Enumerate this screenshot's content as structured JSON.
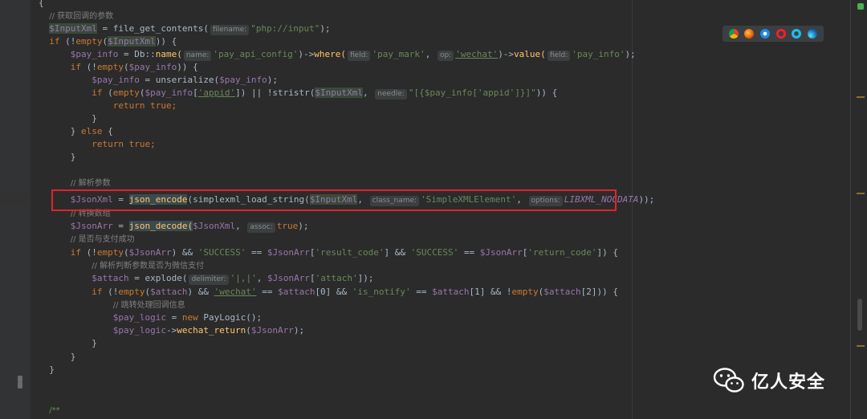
{
  "editor": {
    "lines": {
      "l0_brace": "{",
      "l1_comment": "// 获取回调的参数",
      "l2": {
        "var": "$InputXml",
        "assign": " = ",
        "fn": "file_get_contents(",
        "hint": "filename:",
        "str": "\"php://input\"",
        "end": ");"
      },
      "l3": {
        "kw": "if",
        "a": " (!",
        "fn": "empty",
        "b": "(",
        "var": "$InputXml",
        "end": ")) {"
      },
      "l4": {
        "var": "$pay_info",
        "a": " = Db::",
        "fn": "name(",
        "hint1": "name:",
        "str1": "'pay_api_config'",
        "b": ")->",
        "fn2": "where(",
        "hint2": "field:",
        "str2": "'pay_mark'",
        "c": ", ",
        "hint3": "op:",
        "str3": "'wechat'",
        "d": ")->",
        "fn3": "value(",
        "hint4": "field:",
        "str4": "'pay_info'",
        "end": ");"
      },
      "l5": {
        "kw": "if",
        "a": " (!",
        "fn": "empty",
        "b": "(",
        "var": "$pay_info",
        "end": ")) {"
      },
      "l6": {
        "var": "$pay_info",
        "a": " = unserialize(",
        "var2": "$pay_info",
        "end": ");"
      },
      "l7": {
        "kw": "if",
        "a": " (",
        "fn": "empty",
        "b": "(",
        "var": "$pay_info",
        "c": "[",
        "str": "'appid'",
        "d": "]) || !stristr(",
        "var2": "$InputXml",
        "e": ", ",
        "hint": "needle:",
        "str2": "\"[{$pay_info['appid']}]\"",
        "end": ")) {"
      },
      "l8": {
        "kw": "return",
        "kw2": "true",
        "end": ";"
      },
      "l9": "}",
      "l10": {
        "a": "} ",
        "kw": "else",
        "end": " {"
      },
      "l11": {
        "kw": "return",
        "kw2": "true",
        "end": ";"
      },
      "l12": "}",
      "l13_comment": "// 解析参数",
      "l14": {
        "var": "$JsonXml",
        "a": " = ",
        "fn": "json_encode",
        "b": "(simplexml_load_string(",
        "var2": "$InputXml",
        "c": ", ",
        "hint1": "class_name:",
        "str": "'SimpleXMLElement'",
        "d": ", ",
        "hint2": "options:",
        "const": "LIBXML_NOCDATA",
        "end": "));"
      },
      "l15_comment": "// 转换数组",
      "l16": {
        "var": "$JsonArr",
        "a": " = ",
        "fn": "json_decode(",
        "var2": "$JsonXml",
        "b": ", ",
        "hint": "assoc:",
        "kw": "true",
        "end": ");"
      },
      "l17_comment": "// 是否与支付成功",
      "l18": {
        "kw": "if",
        "a": " (!",
        "fn": "empty",
        "b": "(",
        "var": "$JsonArr",
        "c": ") && ",
        "str": "'SUCCESS'",
        "d": " == ",
        "var2": "$JsonArr",
        "e": "[",
        "str2": "'result_code'",
        "f": "] && ",
        "str3": "'SUCCESS'",
        "g": " == ",
        "var3": "$JsonArr",
        "h": "[",
        "str4": "'return_code'",
        "end": "]) {"
      },
      "l19_comment": "// 解析判断参数是否为微信支付",
      "l20": {
        "var": "$attach",
        "a": " = explode(",
        "hint": "delimiter:",
        "str": "'|,|'",
        "b": ", ",
        "var2": "$JsonArr",
        "c": "[",
        "str2": "'attach'",
        "end": "]);"
      },
      "l21": {
        "kw": "if",
        "a": " (!",
        "fn": "empty",
        "b": "(",
        "var": "$attach",
        "c": ") && ",
        "str": "'wechat'",
        "d": " == ",
        "var2": "$attach",
        "e": "[0] && ",
        "str2": "'is_notify'",
        "f": " == ",
        "var3": "$attach",
        "g": "[1] && !",
        "fn2": "empty",
        "h": "(",
        "var4": "$attach",
        "end": "[2])) {"
      },
      "l22_comment": "// 跳转处理回调信息",
      "l23": {
        "var": "$pay_logic",
        "a": " = ",
        "kw": "new",
        "end": " PayLogic();"
      },
      "l24": {
        "var": "$pay_logic",
        "a": "->",
        "fn": "wechat_return",
        "b": "(",
        "var2": "$JsonArr",
        "end": ");"
      },
      "l25": "}",
      "l26": "}",
      "l27": "}",
      "l28": "/**"
    }
  },
  "browsers": [
    "chrome-icon",
    "firefox-icon",
    "safari-icon",
    "opera-icon",
    "ie-icon",
    "edge-icon"
  ],
  "watermark": {
    "text": "亿人安全",
    "icon": "wechat-logo-icon"
  },
  "colors": {
    "background": "#2b2b2b",
    "highlight_box": "#e0232a",
    "keyword": "#cc7832",
    "string": "#6a8759",
    "variable": "#9876aa",
    "comment": "#808080"
  }
}
